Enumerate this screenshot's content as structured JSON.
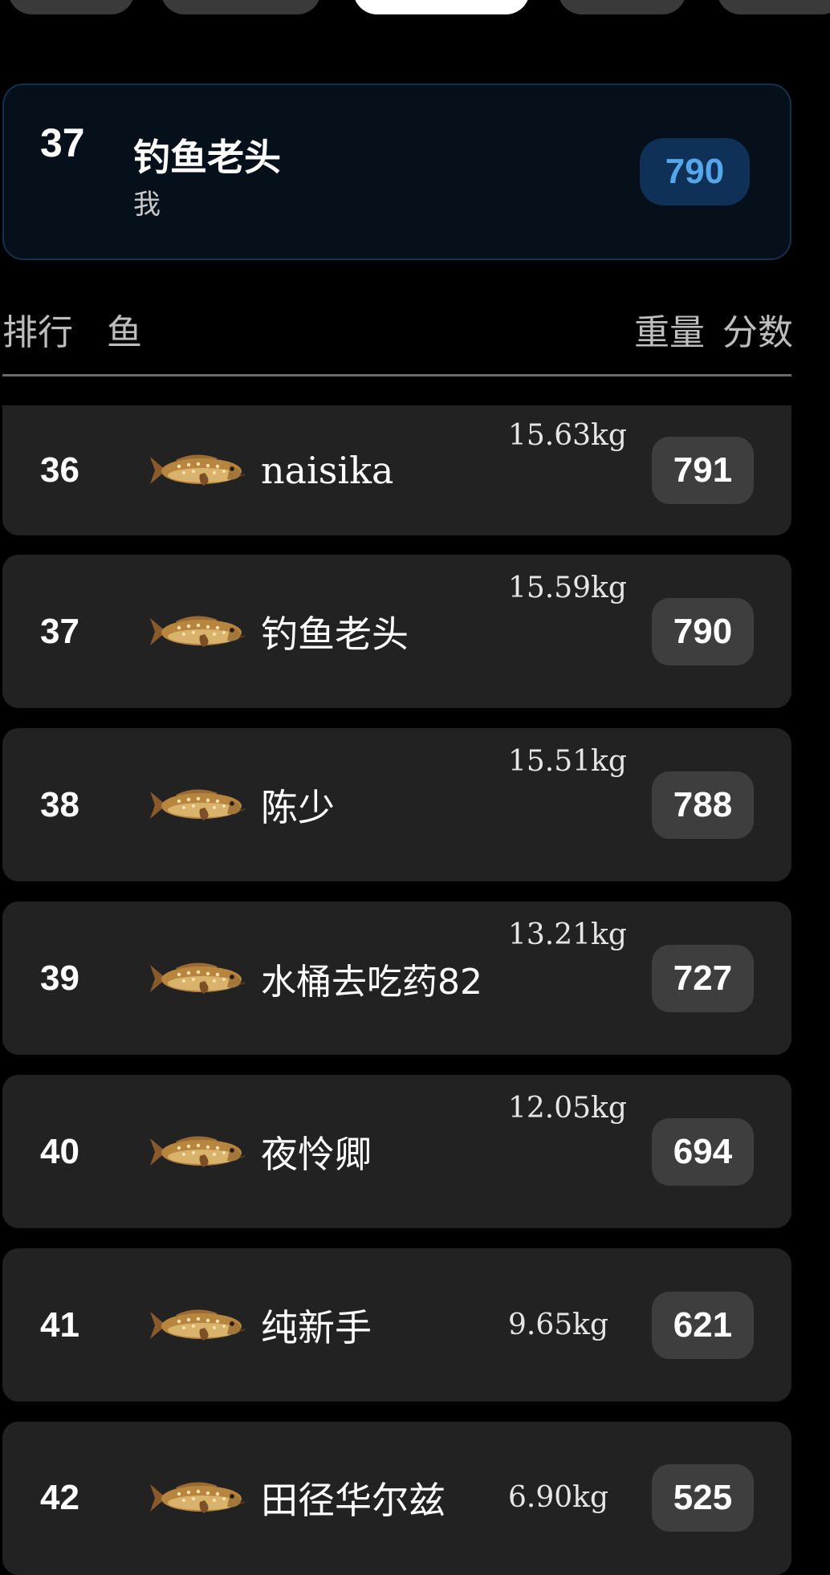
{
  "colors": {
    "background": "#000000",
    "card": "#222222",
    "me_card": "#06101a",
    "me_score_bg": "#0f3157",
    "me_score_text": "#55a7ea",
    "score_badge": "#3e3e3e"
  },
  "me": {
    "rank": "37",
    "name": "钓鱼老头",
    "subtitle": "我",
    "score": "790"
  },
  "header": {
    "rank": "排行",
    "fish": "鱼",
    "weight": "重量",
    "score": "分数"
  },
  "rows": [
    {
      "rank": "36",
      "fish_icon": "grouper-fish-icon",
      "name": "naisika",
      "weight": "15.63kg",
      "score": "791"
    },
    {
      "rank": "37",
      "fish_icon": "grouper-fish-icon",
      "name": "钓鱼老头",
      "weight": "15.59kg",
      "score": "790"
    },
    {
      "rank": "38",
      "fish_icon": "grouper-fish-icon",
      "name": "陈少",
      "weight": "15.51kg",
      "score": "788"
    },
    {
      "rank": "39",
      "fish_icon": "grouper-fish-icon",
      "name": "水桶去吃药82",
      "weight": "13.21kg",
      "score": "727"
    },
    {
      "rank": "40",
      "fish_icon": "grouper-fish-icon",
      "name": "夜怜卿",
      "weight": "12.05kg",
      "score": "694"
    },
    {
      "rank": "41",
      "fish_icon": "grouper-fish-icon",
      "name": "纯新手",
      "weight": "9.65kg",
      "score": "621"
    },
    {
      "rank": "42",
      "fish_icon": "grouper-fish-icon",
      "name": "田径华尔兹",
      "weight": "6.90kg",
      "score": "525"
    }
  ]
}
